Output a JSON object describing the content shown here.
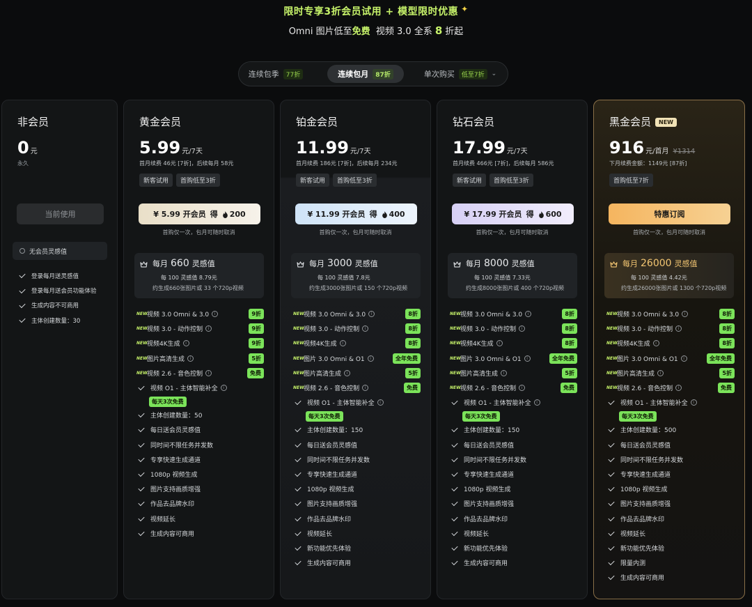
{
  "promo": {
    "title": "限时专享3折会员试用 + 模型限时优惠",
    "sub_omni": "Omni 图片低至",
    "sub_free": "免费",
    "sub_video": "视频 3.0 全系",
    "sub_8": "8",
    "sub_end": "折起"
  },
  "billing": {
    "tabs": [
      {
        "label": "连续包季",
        "tag": "77折"
      },
      {
        "label": "连续包月",
        "tag": "87折"
      },
      {
        "label": "单次购买",
        "tag": "低至7折"
      }
    ],
    "active_index": 1
  },
  "free": {
    "name": "非会员",
    "price": "0",
    "unit": "元",
    "period": "永久",
    "cta": "当前使用",
    "status": "无会员灵感值",
    "features": [
      "登录每月送灵感值",
      "登录每月送会员功能体验",
      "生成内容不可商用",
      "主体创建数量：30"
    ]
  },
  "gold": {
    "name": "黄金会员",
    "price": "5.99",
    "unit": "元/7天",
    "sub": "首月续费 46元 [7折]，后续每月 58元",
    "tags": [
      "新客试用",
      "首购低至3折"
    ],
    "cta_price": "¥ 5.99 开会员",
    "cta_bonus": "得",
    "cta_pts": "200",
    "note": "首购仅一次，包月可随时取消",
    "quota_label": "每月",
    "quota_value": "660",
    "quota_unit": "灵感值",
    "quota_l2": "每 100 灵感值 8.79元",
    "quota_l3": "约生成660张图片或 33 个720p视频",
    "features": [
      {
        "t": "视频 3.0 Omni & 3.0",
        "new": true,
        "info": true,
        "disc": "9折"
      },
      {
        "t": "视频 3.0 - 动作控制",
        "new": true,
        "info": true,
        "disc": "9折"
      },
      {
        "t": "视频4K生成",
        "new": true,
        "info": true,
        "disc": "9折"
      },
      {
        "t": "图片高清生成",
        "new": true,
        "info": true,
        "disc": "5折"
      },
      {
        "t": "视频 2.6 - 音色控制",
        "new": true,
        "info": true,
        "disc": "免费"
      },
      {
        "t": "视频 O1 - 主体智能补全",
        "check": true,
        "info": true,
        "pill": "每天3次免费"
      },
      {
        "t": "主体创建数量：50",
        "check": true
      },
      {
        "t": "每日送会员灵感值",
        "check": true
      },
      {
        "t": "同时间不限任务并发数",
        "check": true
      },
      {
        "t": "专享快速生成通道",
        "check": true
      },
      {
        "t": "1080p 视频生成",
        "check": true
      },
      {
        "t": "图片支持画质增强",
        "check": true
      },
      {
        "t": "作品去品牌水印",
        "check": true
      },
      {
        "t": "视频延长",
        "check": true
      },
      {
        "t": "生成内容可商用",
        "check": true
      }
    ]
  },
  "plat": {
    "name": "铂金会员",
    "price": "11.99",
    "unit": "元/7天",
    "sub": "首月续费 186元 [7折]，后续每月 234元",
    "tags": [
      "新客试用",
      "首购低至3折"
    ],
    "cta_price": "¥ 11.99 开会员",
    "cta_bonus": "得",
    "cta_pts": "400",
    "note": "首购仅一次，包月可随时取消",
    "quota_label": "每月",
    "quota_value": "3000",
    "quota_unit": "灵感值",
    "quota_l2": "每 100 灵感值 7.8元",
    "quota_l3": "约生成3000张图片或 150 个720p视频",
    "features": [
      {
        "t": "视频 3.0 Omni & 3.0",
        "new": true,
        "info": true,
        "disc": "8折"
      },
      {
        "t": "视频 3.0 - 动作控制",
        "new": true,
        "info": true,
        "disc": "8折"
      },
      {
        "t": "视频4K生成",
        "new": true,
        "info": true,
        "disc": "8折"
      },
      {
        "t": "图片 3.0 Omni & O1",
        "new": true,
        "info": true,
        "disc": "全年免费"
      },
      {
        "t": "图片高清生成",
        "new": true,
        "info": true,
        "disc": "5折"
      },
      {
        "t": "视频 2.6 - 音色控制",
        "new": true,
        "info": true,
        "disc": "免费"
      },
      {
        "t": "视频 O1 - 主体智能补全",
        "check": true,
        "info": true,
        "pill": "每天3次免费"
      },
      {
        "t": "主体创建数量：150",
        "check": true
      },
      {
        "t": "每日送会员灵感值",
        "check": true
      },
      {
        "t": "同时间不限任务并发数",
        "check": true
      },
      {
        "t": "专享快速生成通道",
        "check": true
      },
      {
        "t": "1080p 视频生成",
        "check": true
      },
      {
        "t": "图片支持画质增强",
        "check": true
      },
      {
        "t": "作品去品牌水印",
        "check": true
      },
      {
        "t": "视频延长",
        "check": true
      },
      {
        "t": "新功能优先体验",
        "check": true
      },
      {
        "t": "生成内容可商用",
        "check": true
      }
    ]
  },
  "diam": {
    "name": "钻石会员",
    "price": "17.99",
    "unit": "元/7天",
    "sub": "首月续费 466元 [7折]，后续每月 586元",
    "tags": [
      "新客试用",
      "首购低至3折"
    ],
    "cta_price": "¥ 17.99 开会员",
    "cta_bonus": "得",
    "cta_pts": "600",
    "note": "首购仅一次，包月可随时取消",
    "quota_label": "每月",
    "quota_value": "8000",
    "quota_unit": "灵感值",
    "quota_l2": "每 100 灵感值 7.33元",
    "quota_l3": "约生成8000张图片或 400 个720p视频",
    "features": [
      {
        "t": "视频 3.0 Omni & 3.0",
        "new": true,
        "info": true,
        "disc": "8折"
      },
      {
        "t": "视频 3.0 - 动作控制",
        "new": true,
        "info": true,
        "disc": "8折"
      },
      {
        "t": "视频4K生成",
        "new": true,
        "info": true,
        "disc": "8折"
      },
      {
        "t": "图片 3.0 Omni & O1",
        "new": true,
        "info": true,
        "disc": "全年免费"
      },
      {
        "t": "图片高清生成",
        "new": true,
        "info": true,
        "disc": "5折"
      },
      {
        "t": "视频 2.6 - 音色控制",
        "new": true,
        "info": true,
        "disc": "免费"
      },
      {
        "t": "视频 O1 - 主体智能补全",
        "check": true,
        "info": true,
        "pill": "每天3次免费"
      },
      {
        "t": "主体创建数量：150",
        "check": true
      },
      {
        "t": "每日送会员灵感值",
        "check": true
      },
      {
        "t": "同时间不限任务并发数",
        "check": true
      },
      {
        "t": "专享快速生成通道",
        "check": true
      },
      {
        "t": "1080p 视频生成",
        "check": true
      },
      {
        "t": "图片支持画质增强",
        "check": true
      },
      {
        "t": "作品去品牌水印",
        "check": true
      },
      {
        "t": "视频延长",
        "check": true
      },
      {
        "t": "新功能优先体验",
        "check": true
      },
      {
        "t": "生成内容可商用",
        "check": true
      }
    ]
  },
  "black": {
    "name": "黑金会员",
    "badge": "NEW",
    "price": "916",
    "unit": "元/首月",
    "strike": "¥1314",
    "sub": "下月续费金额：1149元 [87折]",
    "tags": [
      "首购低至7折"
    ],
    "cta": "特惠订阅",
    "note": "首购仅一次，包月可随时取消",
    "quota_label": "每月",
    "quota_value": "26000",
    "quota_unit": "灵感值",
    "quota_l2": "每 100 灵感值 4.42元",
    "quota_l3": "约生成26000张图片或 1300 个720p视频",
    "features": [
      {
        "t": "视频 3.0 Omni & 3.0",
        "new": true,
        "info": true,
        "disc": "8折"
      },
      {
        "t": "视频 3.0 - 动作控制",
        "new": true,
        "info": true,
        "disc": "8折"
      },
      {
        "t": "视频4K生成",
        "new": true,
        "info": true,
        "disc": "8折"
      },
      {
        "t": "图片 3.0 Omni & O1",
        "new": true,
        "info": true,
        "disc": "全年免费"
      },
      {
        "t": "图片高清生成",
        "new": true,
        "info": true,
        "disc": "5折"
      },
      {
        "t": "视频 2.6 - 音色控制",
        "new": true,
        "info": true,
        "disc": "免费"
      },
      {
        "t": "视频 O1 - 主体智能补全",
        "check": true,
        "info": true,
        "pill": "每天3次免费"
      },
      {
        "t": "主体创建数量：500",
        "check": true
      },
      {
        "t": "每日送会员灵感值",
        "check": true
      },
      {
        "t": "同时间不限任务并发数",
        "check": true
      },
      {
        "t": "专享快速生成通道",
        "check": true
      },
      {
        "t": "1080p 视频生成",
        "check": true
      },
      {
        "t": "图片支持画质增强",
        "check": true
      },
      {
        "t": "作品去品牌水印",
        "check": true
      },
      {
        "t": "视频延长",
        "check": true
      },
      {
        "t": "新功能优先体验",
        "check": true
      },
      {
        "t": "限量内测",
        "check": true
      },
      {
        "t": "生成内容可商用",
        "check": true
      }
    ]
  },
  "icons": {
    "new": "NEW",
    "info": "i",
    "dropdown": "chevron-down-icon",
    "crown": "crown-icon",
    "fire": "fire-icon"
  },
  "colors": {
    "accent_green": "#c6f26a",
    "discount_badge": "#7be35a",
    "black_gold": "#f2c572",
    "background": "#0b0c0d"
  }
}
